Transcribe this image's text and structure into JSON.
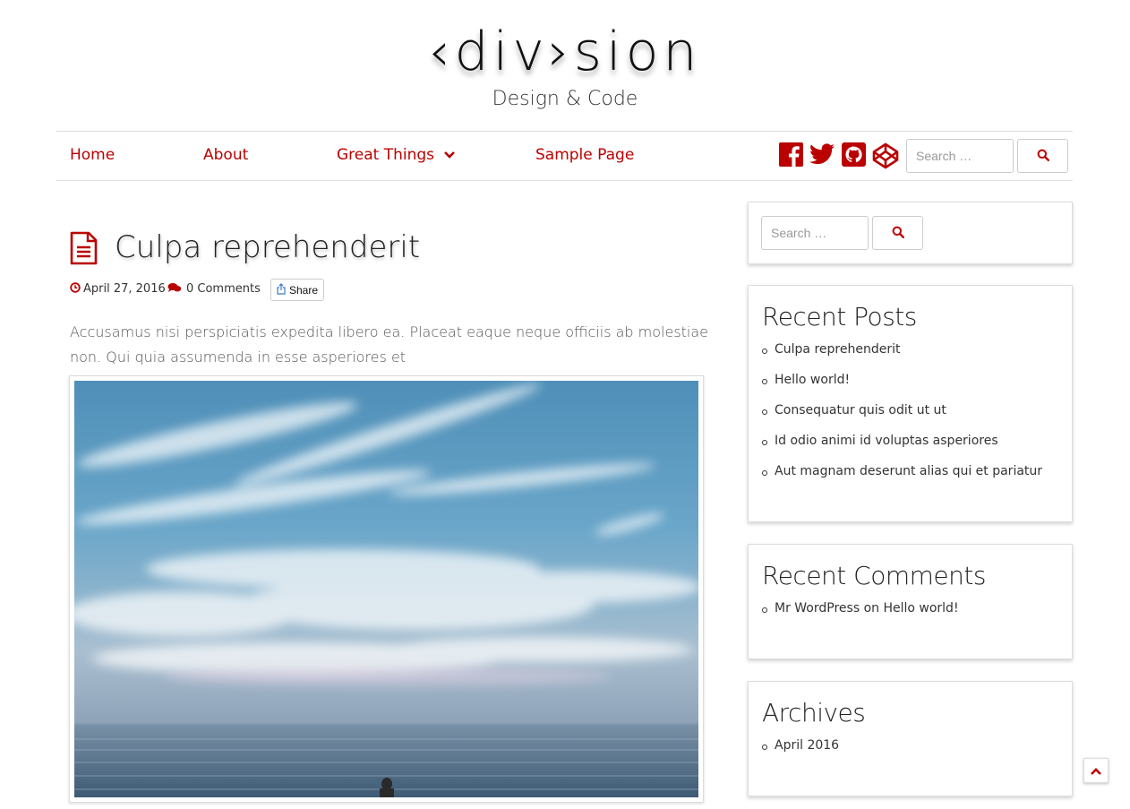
{
  "site": {
    "logo_text": "‹div›sion",
    "tagline": "Design & Code"
  },
  "nav": {
    "items": [
      {
        "label": "Home"
      },
      {
        "label": "About"
      },
      {
        "label": "Great Things"
      },
      {
        "label": "Sample Page"
      }
    ],
    "social_icons": [
      "facebook-icon",
      "twitter-icon",
      "github-icon",
      "codepen-icon"
    ],
    "search_placeholder": "Search …"
  },
  "post": {
    "title": "Culpa reprehenderit",
    "date": "April 27, 2016",
    "comments": "0 Comments",
    "share_label": "Share",
    "excerpt": "Accusamus nisi perspiciatis expedita libero ea. Placeat eaque neque officiis ab molestiae non. Qui quia assumenda in esse asperiores et"
  },
  "sidebar": {
    "search_placeholder": "Search …",
    "recent_posts": {
      "title": "Recent Posts",
      "items": [
        "Culpa reprehenderit",
        "Hello world!",
        "Consequatur quis odit ut ut",
        "Id odio animi id voluptas asperiores",
        "Aut magnam deserunt alias qui et pariatur"
      ]
    },
    "recent_comments": {
      "title": "Recent Comments",
      "items": [
        "Mr WordPress on Hello world!"
      ]
    },
    "archives": {
      "title": "Archives",
      "items": [
        "April 2016"
      ]
    }
  },
  "colors": {
    "accent": "#b00000",
    "text": "#333333"
  }
}
